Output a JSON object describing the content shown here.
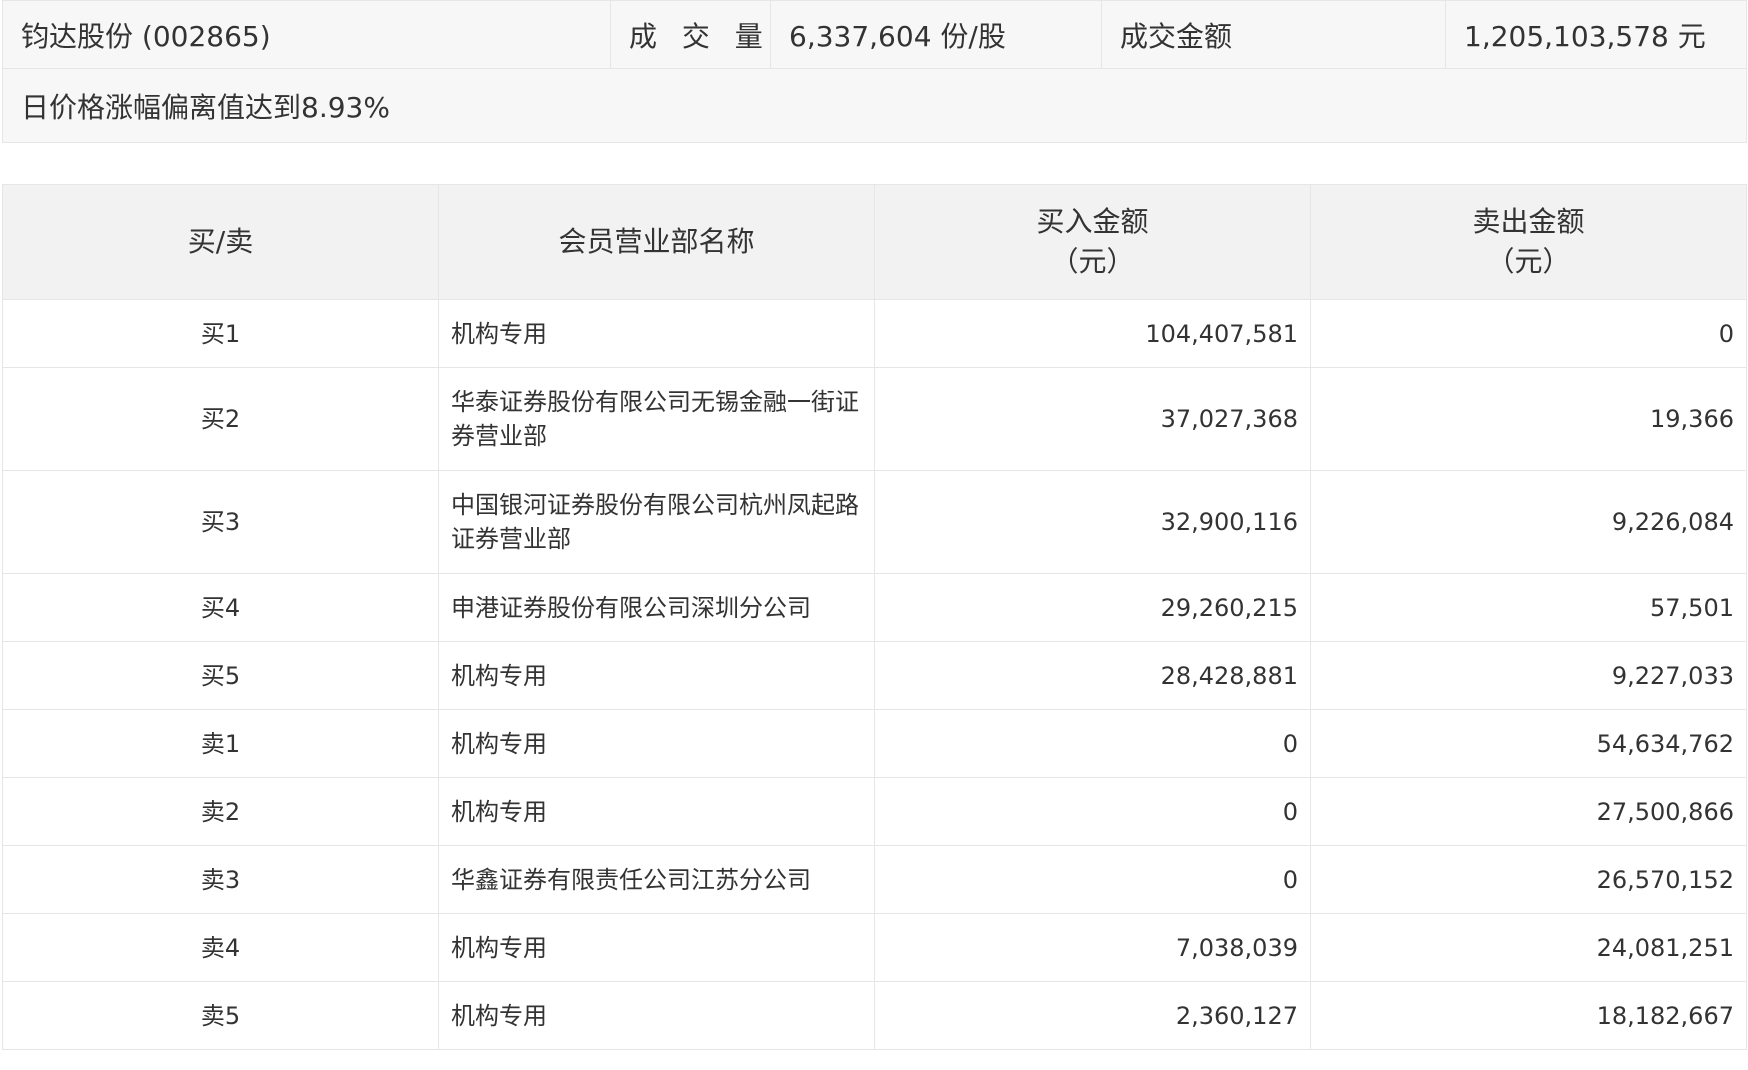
{
  "summary": {
    "stock": "钧达股份 (002865)",
    "volume_label": "成 交 量",
    "volume_value": "6,337,604 份/股",
    "amount_label": "成交金额",
    "amount_value": "1,205,103,578 元",
    "note": "日价格涨幅偏离值达到8.93%"
  },
  "table": {
    "headers": {
      "side": "买/卖",
      "member": "会员营业部名称",
      "buy": "买入金额",
      "sell": "卖出金额",
      "unit": "（元）"
    },
    "rows": [
      {
        "side": "买1",
        "member": "机构专用",
        "buy": "104,407,581",
        "sell": "0"
      },
      {
        "side": "买2",
        "member": "华泰证券股份有限公司无锡金融一街证券营业部",
        "buy": "37,027,368",
        "sell": "19,366"
      },
      {
        "side": "买3",
        "member": "中国银河证券股份有限公司杭州凤起路证券营业部",
        "buy": "32,900,116",
        "sell": "9,226,084"
      },
      {
        "side": "买4",
        "member": "申港证券股份有限公司深圳分公司",
        "buy": "29,260,215",
        "sell": "57,501"
      },
      {
        "side": "买5",
        "member": "机构专用",
        "buy": "28,428,881",
        "sell": "9,227,033"
      },
      {
        "side": "卖1",
        "member": "机构专用",
        "buy": "0",
        "sell": "54,634,762"
      },
      {
        "side": "卖2",
        "member": "机构专用",
        "buy": "0",
        "sell": "27,500,866"
      },
      {
        "side": "卖3",
        "member": "华鑫证券有限责任公司江苏分公司",
        "buy": "0",
        "sell": "26,570,152"
      },
      {
        "side": "卖4",
        "member": "机构专用",
        "buy": "7,038,039",
        "sell": "24,081,251"
      },
      {
        "side": "卖5",
        "member": "机构专用",
        "buy": "2,360,127",
        "sell": "18,182,667"
      }
    ]
  }
}
